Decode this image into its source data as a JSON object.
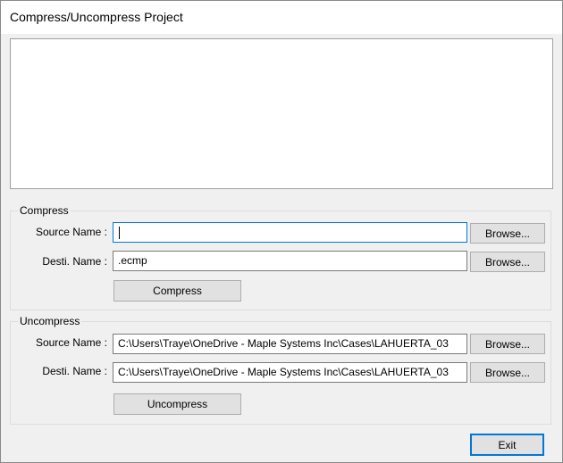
{
  "window": {
    "title": "Compress/Uncompress Project"
  },
  "log": {
    "content": ""
  },
  "compress": {
    "group_label": "Compress",
    "source_label": "Source Name :",
    "source_value": "",
    "dest_label": "Desti. Name :",
    "dest_value": ".ecmp",
    "browse_label": "Browse...",
    "action_label": "Compress"
  },
  "uncompress": {
    "group_label": "Uncompress",
    "source_label": "Source Name :",
    "source_value": "C:\\Users\\Traye\\OneDrive - Maple Systems Inc\\Cases\\LAHUERTA_03",
    "dest_label": "Desti. Name :",
    "dest_value": "C:\\Users\\Traye\\OneDrive - Maple Systems Inc\\Cases\\LAHUERTA_03",
    "browse_label": "Browse...",
    "action_label": "Uncompress"
  },
  "footer": {
    "exit_label": "Exit"
  }
}
